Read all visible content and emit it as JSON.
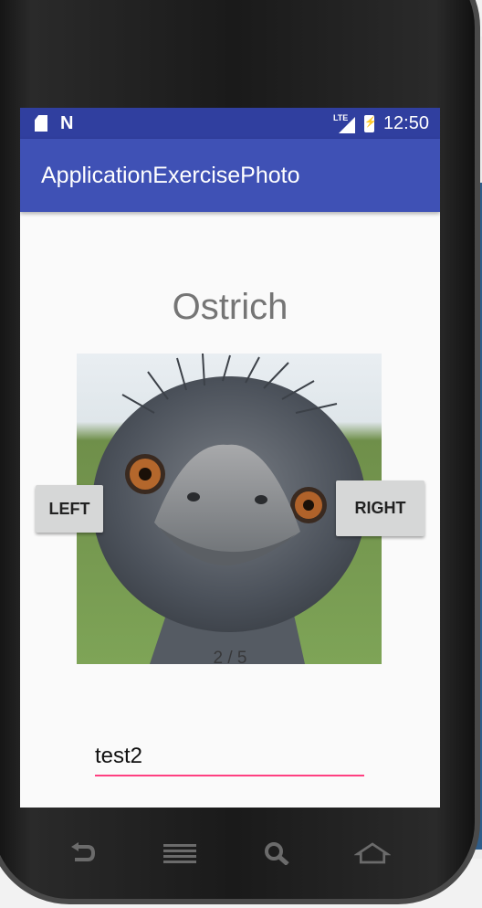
{
  "status_bar": {
    "time": "12:50",
    "network": "LTE",
    "icons": [
      "sd-card-icon",
      "nfc-icon",
      "lte-signal-icon",
      "battery-charging-icon"
    ]
  },
  "app_bar": {
    "title": "ApplicationExercisePhoto"
  },
  "main": {
    "animal_name": "Ostrich",
    "photo_alt": "Ostrich",
    "left_button": "LEFT",
    "right_button": "RIGHT",
    "counter": "2 / 5",
    "input_value": "test2"
  },
  "nav_bar": {
    "buttons": [
      "back-icon",
      "menu-icon",
      "search-icon",
      "home-icon"
    ]
  },
  "colors": {
    "status_bar": "#303f9f",
    "app_bar": "#3f51b5",
    "input_underline": "#ff4081",
    "button": "#d6d7d7"
  }
}
